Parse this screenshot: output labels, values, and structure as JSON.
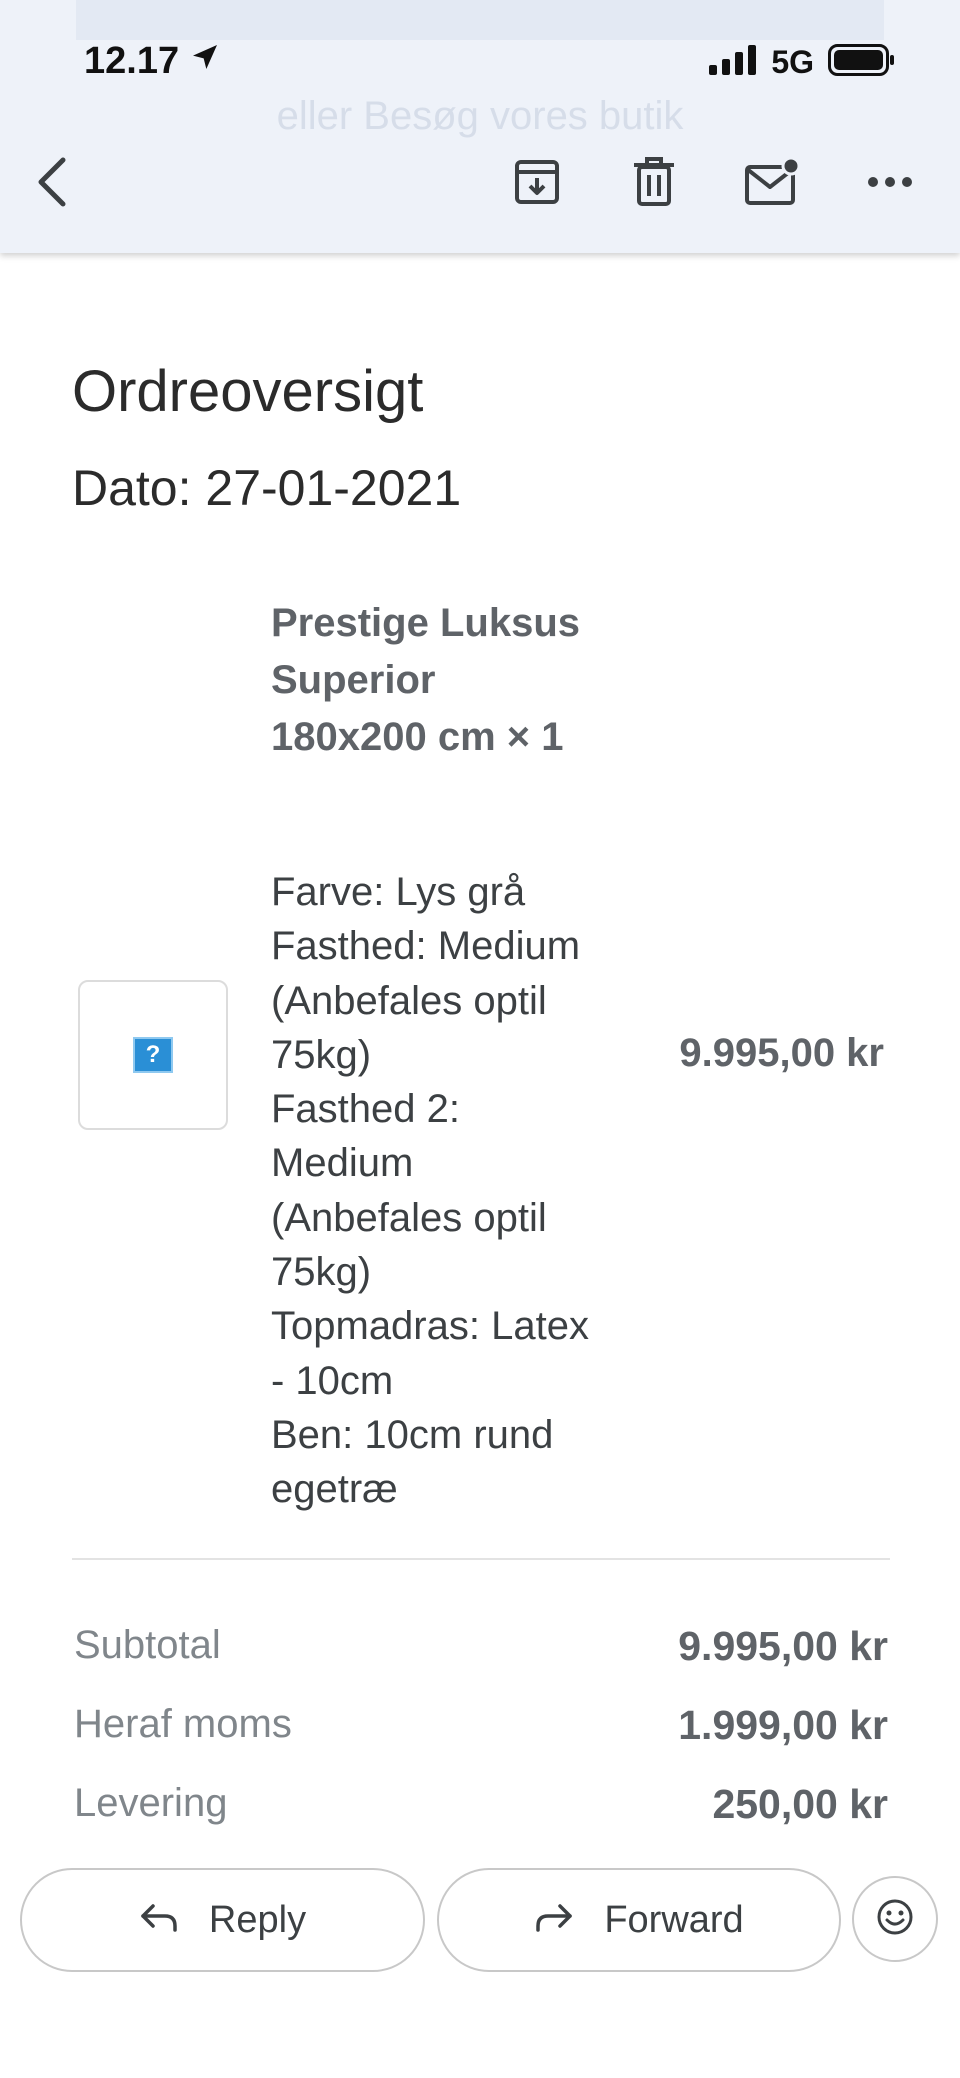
{
  "status_bar": {
    "time": "12.17",
    "network": "5G",
    "icons": [
      "location-arrow-icon",
      "signal-bars-icon",
      "battery-icon"
    ]
  },
  "background_text": "eller Besøg vores butik",
  "toolbar": {
    "icons": [
      "back-arrow-icon",
      "archive-icon",
      "delete-icon",
      "mark-unread-icon",
      "more-options-icon"
    ]
  },
  "order": {
    "title": "Ordreoversigt",
    "date": "Dato: 27-01-2021",
    "item": {
      "name_lines": [
        "Prestige Luksus",
        "Superior",
        "180x200 cm × 1"
      ],
      "options_lines": [
        "Farve: Lys grå",
        "Fasthed: Medium",
        "(Anbefales optil",
        "75kg)",
        "Fasthed 2:",
        "Medium",
        "(Anbefales optil",
        "75kg)",
        "Topmadras: Latex",
        "- 10cm",
        "Ben: 10cm rund",
        "egetræ"
      ],
      "image_placeholder": "?",
      "price": "9.995,00 kr"
    },
    "totals": [
      {
        "label": "Subtotal",
        "value": "9.995,00 kr"
      },
      {
        "label": "Heraf moms",
        "value": "1.999,00 kr"
      },
      {
        "label": "Levering",
        "value": "250,00 kr"
      }
    ]
  },
  "actions": {
    "reply_label": "Reply",
    "forward_label": "Forward"
  },
  "colors": {
    "toolbar_bg": "#eef2f9",
    "text_primary": "#2b2b2b",
    "text_secondary": "#5f6368",
    "placeholder_blue": "#2a8fd6"
  }
}
